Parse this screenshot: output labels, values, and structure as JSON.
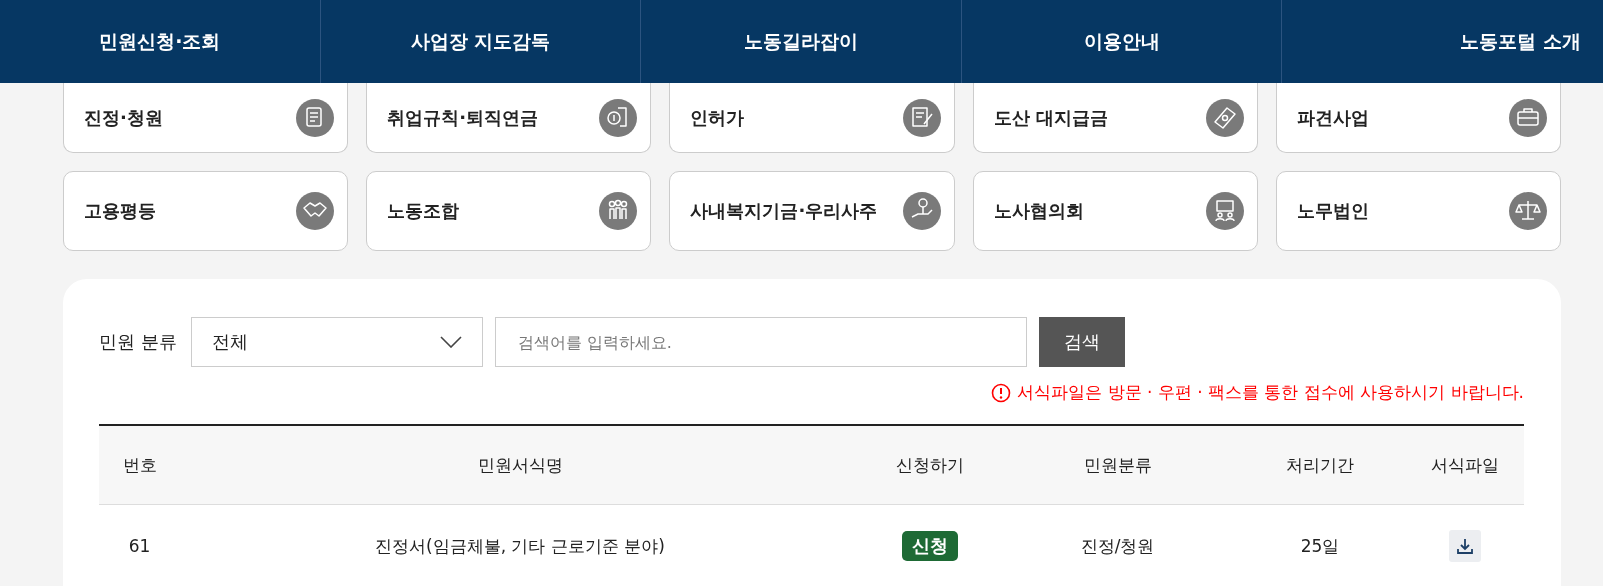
{
  "nav": [
    {
      "label": "민원신청·조회"
    },
    {
      "label": "사업장 지도감독"
    },
    {
      "label": "노동길라잡이"
    },
    {
      "label": "이용안내"
    },
    {
      "label": "노동포털 소개"
    }
  ],
  "categories": [
    {
      "label": "진정·청원"
    },
    {
      "label": "취업규칙·퇴직연금"
    },
    {
      "label": "인허가"
    },
    {
      "label": "도산 대지급금"
    },
    {
      "label": "파견사업"
    },
    {
      "label": "고용평등"
    },
    {
      "label": "노동조합"
    },
    {
      "label": "사내복지기금·우리사주"
    },
    {
      "label": "노사협의회"
    },
    {
      "label": "노무법인"
    }
  ],
  "search": {
    "label": "민원 분류",
    "select_value": "전체",
    "placeholder": "검색어를 입력하세요.",
    "button": "검색"
  },
  "notice": "서식파일은 방문 · 우편 · 팩스를 통한 접수에 사용하시기 바랍니다.",
  "table": {
    "columns": [
      "번호",
      "민원서식명",
      "신청하기",
      "민원분류",
      "처리기간",
      "서식파일"
    ],
    "rows": [
      {
        "number": "61",
        "name": "진정서(임금체불, 기타 근로기준 분야)",
        "apply": "신청",
        "category": "진정/청원",
        "period": "25일"
      }
    ]
  }
}
